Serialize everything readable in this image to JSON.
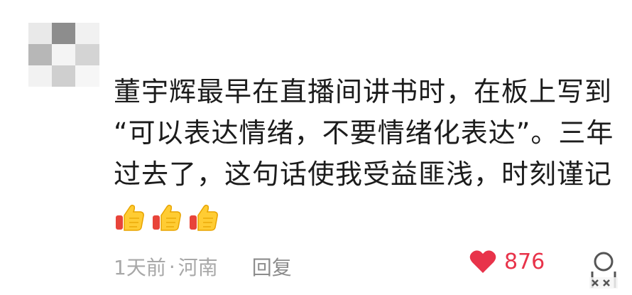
{
  "comment": {
    "text_lines": [
      "董宇辉最早在直播间讲书时，在板上写到",
      "“可以表达情绪，不要情绪化表达”。三年",
      "过去了，这句话使我受益匪浅，时刻谨记"
    ],
    "emoji": [
      "thumbs-up-icon",
      "thumbs-up-icon",
      "thumbs-up-icon"
    ],
    "time": "1天前",
    "separator": "·",
    "location": "河南",
    "reply_label": "回复",
    "like_count": "876"
  },
  "colors": {
    "text": "#1c1c1c",
    "meta": "#a8a8a8",
    "like": "#e8334a"
  }
}
